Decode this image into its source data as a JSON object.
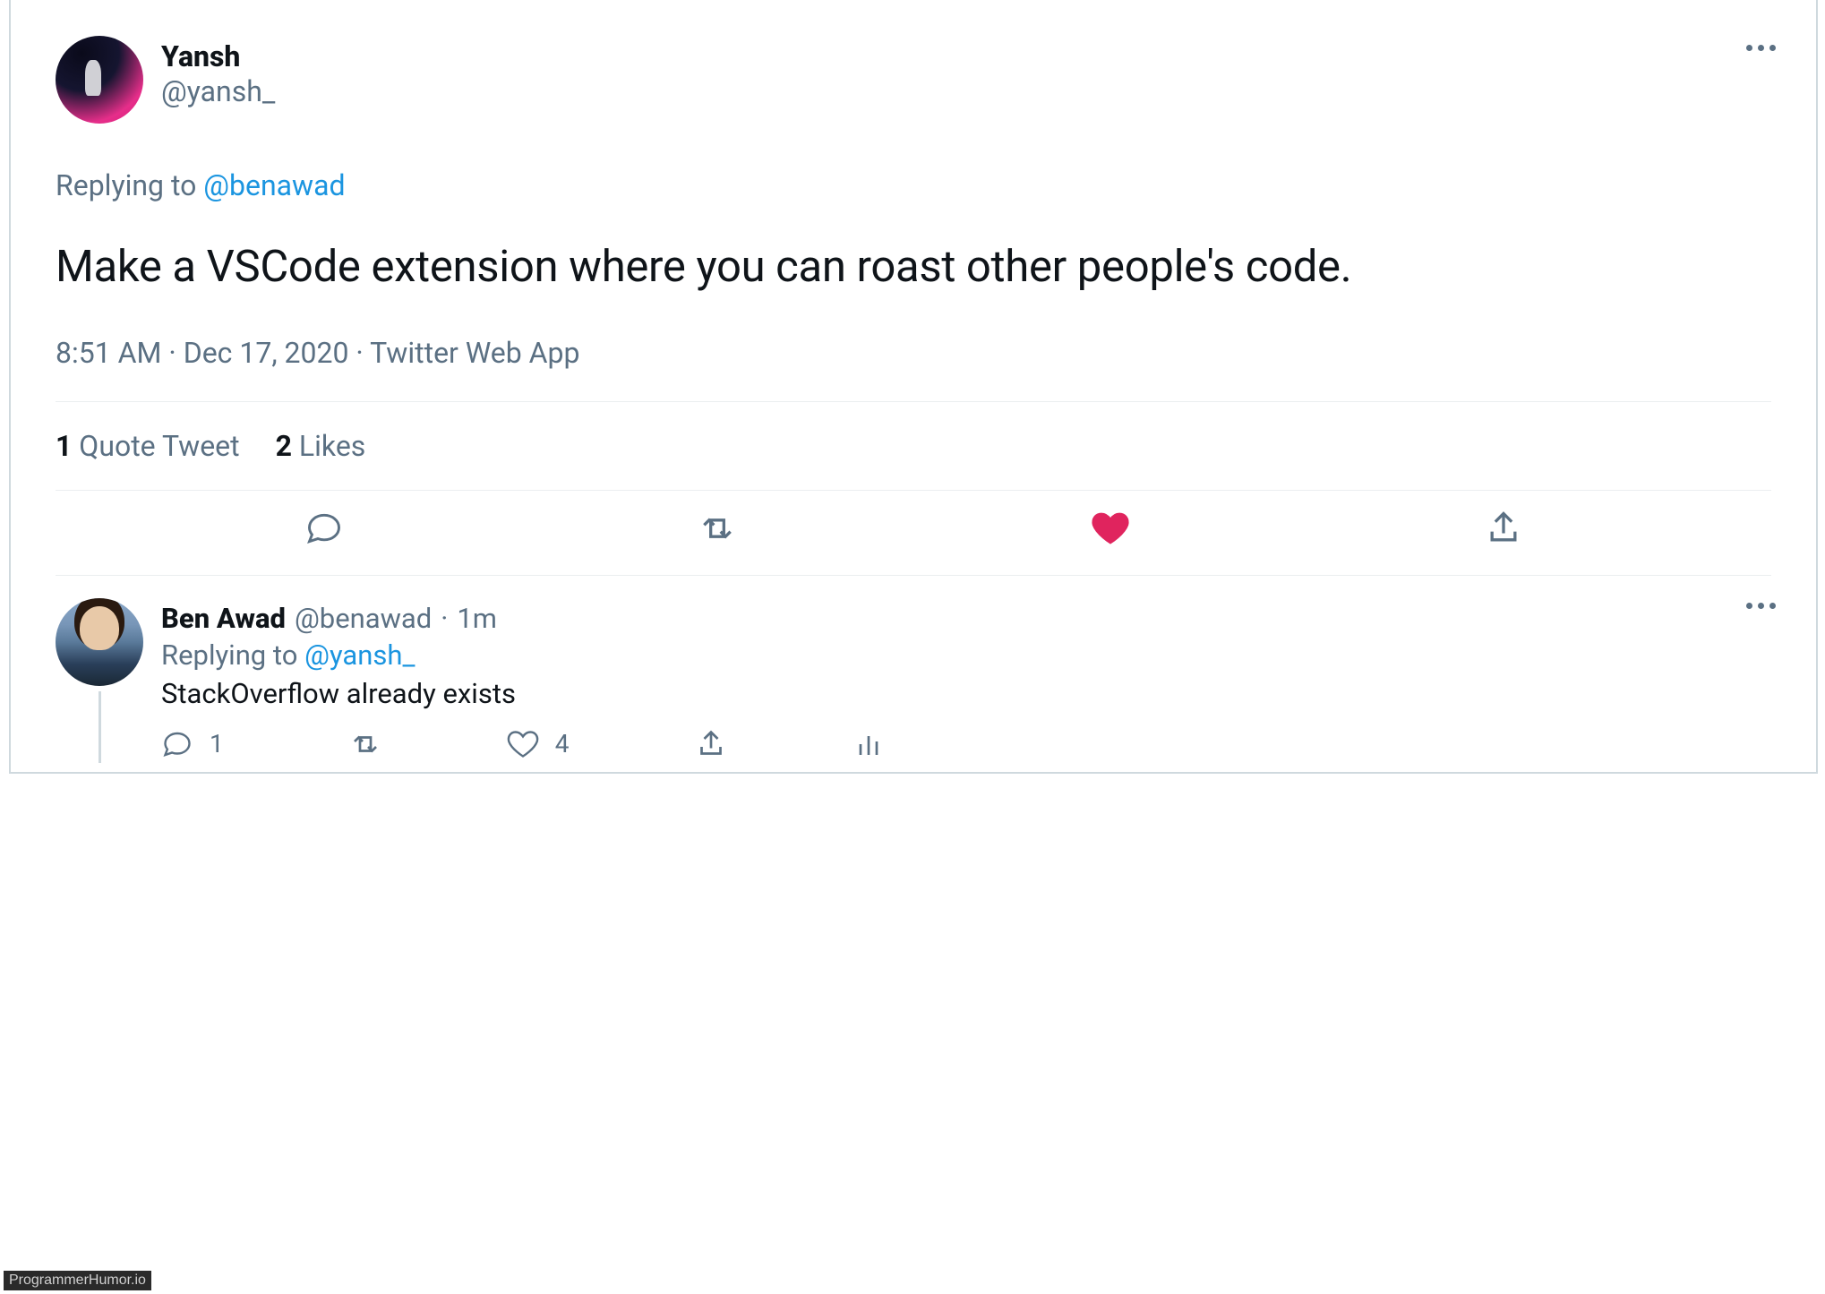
{
  "main": {
    "author": {
      "display": "Yansh",
      "handle": "@yansh_"
    },
    "replying_prefix": "Replying to ",
    "replying_to": "@benawad",
    "text": "Make a VSCode extension where you can roast other people's code.",
    "time": "8:51 AM",
    "date": "Dec 17, 2020",
    "source": "Twitter Web App",
    "sep": " · ",
    "stats": {
      "quote_count": "1",
      "quote_label": " Quote Tweet",
      "like_count": "2",
      "like_label": " Likes"
    }
  },
  "reply": {
    "author": {
      "display": "Ben Awad",
      "handle": "@benawad"
    },
    "age": "1m",
    "dot": " · ",
    "replying_prefix": "Replying to ",
    "replying_to": "@yansh_",
    "text": "StackOverflow already exists",
    "counts": {
      "replies": "1",
      "likes": "4"
    }
  },
  "watermark": "ProgrammerHumor.io"
}
